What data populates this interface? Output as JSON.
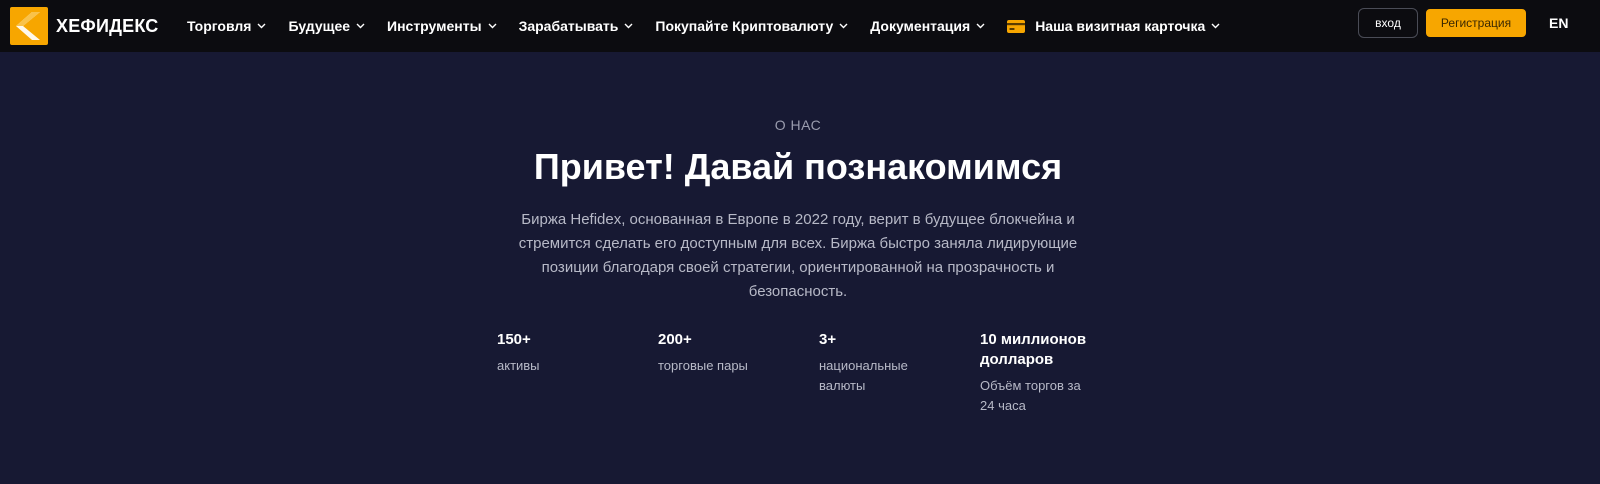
{
  "header": {
    "brand": "ХЕФИДЕКС",
    "nav": [
      {
        "label": "Торговля",
        "icon": "chevron-down-icon"
      },
      {
        "label": "Будущее",
        "icon": "chevron-down-icon"
      },
      {
        "label": "Инструменты",
        "icon": "chevron-down-icon"
      },
      {
        "label": "Зарабатывать",
        "icon": "chevron-down-icon"
      },
      {
        "label": "Покупайте Криптовалюту",
        "icon": "chevron-down-icon"
      },
      {
        "label": "Документация",
        "icon": "chevron-down-icon"
      },
      {
        "label": "Наша визитная карточка",
        "icon": "card-icon",
        "dropdown_icon": "chevron-down-icon"
      }
    ],
    "login_label": "вход",
    "signup_label": "Регистрация",
    "language": "EN"
  },
  "hero": {
    "eyebrow": "О НАС",
    "title": "Привет! Давай познакомимся",
    "description": "Биржа Hefidex, основанная в Европе в 2022 году, верит в будущее блокчейна и стремится сделать его доступным для всех. Биржа быстро заняла лидирующие позиции благодаря своей стратегии, ориентированной на прозрачность и безопасность."
  },
  "stats": [
    {
      "value": "150+",
      "label": "активы"
    },
    {
      "value": "200+",
      "label": "торговые пары"
    },
    {
      "value": "3+",
      "label": "национальные валюты"
    },
    {
      "value": "10 миллионов долларов",
      "label": "Объём торгов за 24 часа"
    }
  ],
  "colors": {
    "accent": "#f7a600",
    "header_bg": "#0c0c10",
    "page_bg": "#171933",
    "muted_text": "#b7b9c7"
  }
}
